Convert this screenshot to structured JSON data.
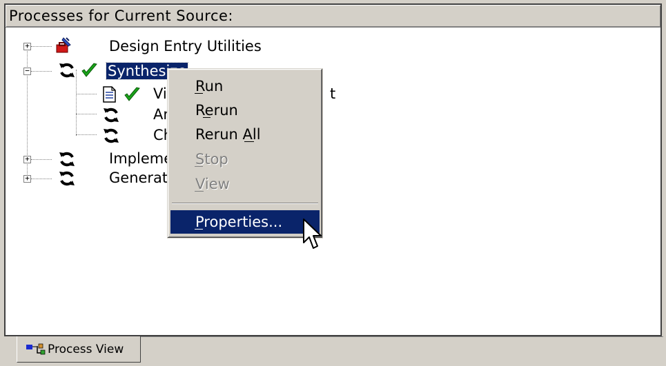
{
  "panel": {
    "title": "Processes for Current Source:"
  },
  "tree": {
    "items": [
      {
        "label": "Design Entry Utilities",
        "expander": "+"
      },
      {
        "label": "Synthesize",
        "expander": "−"
      },
      {
        "label": "Vi",
        "suffix": "t"
      },
      {
        "label": "An"
      },
      {
        "label": "Ch"
      },
      {
        "label": "Impleme"
      },
      {
        "label": "Generat"
      }
    ]
  },
  "context_menu": {
    "items": [
      {
        "label": "Run",
        "mnemonic": "R",
        "enabled": true
      },
      {
        "label": "Rerun",
        "mnemonic": "e",
        "enabled": true
      },
      {
        "label": "Rerun All",
        "mnemonic": "A",
        "enabled": true
      },
      {
        "label": "Stop",
        "mnemonic": "S",
        "enabled": false
      },
      {
        "label": "View",
        "mnemonic": "V",
        "enabled": false
      },
      {
        "label": "Properties...",
        "mnemonic": "P",
        "enabled": true,
        "highlighted": true
      }
    ]
  },
  "tabs": [
    {
      "label": "Process View"
    }
  ],
  "colors": {
    "selection": "#0a246a",
    "window": "#d4d0c8",
    "check": "#1aa31a"
  },
  "icons": [
    "toolbox-icon",
    "refresh-icon",
    "checkmark-icon",
    "document-icon",
    "arrow-cursor-icon",
    "process-view-icon"
  ]
}
